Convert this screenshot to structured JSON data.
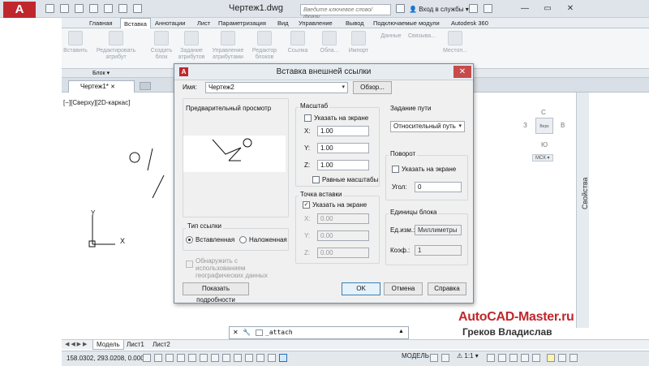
{
  "app": {
    "logo_letter": "A",
    "document_title": "Чертеж1.dwg",
    "search_placeholder": "Введите ключевое слово/фразу",
    "signin_label": "Вход в службы",
    "window_controls": [
      "minimize-icon",
      "maximize-icon",
      "close-icon"
    ]
  },
  "ribbon": {
    "tabs": [
      "Главная",
      "Вставка",
      "Аннотации",
      "Лист",
      "Параметризация",
      "Вид",
      "Управление",
      "Вывод",
      "Подключаемые модули",
      "Autodesk 360"
    ],
    "active_tab": "Вставка",
    "buttons": [
      {
        "label": "Вставить"
      },
      {
        "label": "Редактировать атрибут"
      },
      {
        "label": "Создать блок"
      },
      {
        "label": "Задание атрибутов"
      },
      {
        "label": "Управление атрибутами"
      },
      {
        "label": "Редактор блоков"
      },
      {
        "label": "Ссылка"
      },
      {
        "label": "Обла..."
      },
      {
        "label": "Импорт"
      },
      {
        "label": "Данные"
      },
      {
        "label": "Связыва..."
      },
      {
        "label": "Местоп..."
      }
    ],
    "group_label": "Блок"
  },
  "file_tab": {
    "label": "Чертеж1*"
  },
  "viewport": {
    "label": "[−][Сверху][2D-каркас]",
    "axis_y": "Y",
    "axis_x": "X",
    "viewcube": {
      "face": "Верх",
      "n": "С",
      "w": "З",
      "e": "В",
      "s": "Ю"
    },
    "wcs_label": "МСК"
  },
  "side_panel": {
    "label": "Свойства"
  },
  "layout_tabs": [
    "Модель",
    "Лист1",
    "Лист2"
  ],
  "command_line": {
    "text": "_attach"
  },
  "status_bar": {
    "coords": "158.0302, 293.0208, 0.0000",
    "model_label": "МОДЕЛЬ",
    "scale_label": "1:1"
  },
  "watermark": {
    "site": "AutoCAD-Master.ru",
    "author": "Греков Владислав"
  },
  "dialog": {
    "title": "Вставка внешней ссылки",
    "name_label": "Имя:",
    "name_value": "Чертеж2",
    "browse_button": "Обзор...",
    "preview_label": "Предварительный просмотр",
    "scale": {
      "label": "Масштаб",
      "on_screen": "Указать на экране",
      "x_label": "X:",
      "y_label": "Y:",
      "z_label": "Z:",
      "x": "1.00",
      "y": "1.00",
      "z": "1.00",
      "uniform": "Равные масштабы"
    },
    "insertion": {
      "label": "Точка вставки",
      "on_screen": "Указать на экране",
      "x_label": "X:",
      "y_label": "Y:",
      "z_label": "Z:",
      "x": "0.00",
      "y": "0.00",
      "z": "0.00"
    },
    "path": {
      "label": "Задание пути",
      "value": "Относительный путь"
    },
    "rotation": {
      "label": "Поворот",
      "on_screen": "Указать на экране",
      "angle_label": "Угол:",
      "angle": "0"
    },
    "block_units": {
      "label": "Единицы блока",
      "units_label": "Ед.изм.:",
      "units_value": "Миллиметры",
      "factor_label": "Коэф.:",
      "factor_value": "1"
    },
    "ref_type": {
      "label": "Тип ссылки",
      "attached": "Вставленная",
      "overlay": "Наложенная",
      "selected": "attached"
    },
    "geo_label": "Обнаружить с использованием географических данных",
    "details_button": "Показать подробности",
    "ok_button": "OK",
    "cancel_button": "Отмена",
    "help_button": "Справка"
  }
}
